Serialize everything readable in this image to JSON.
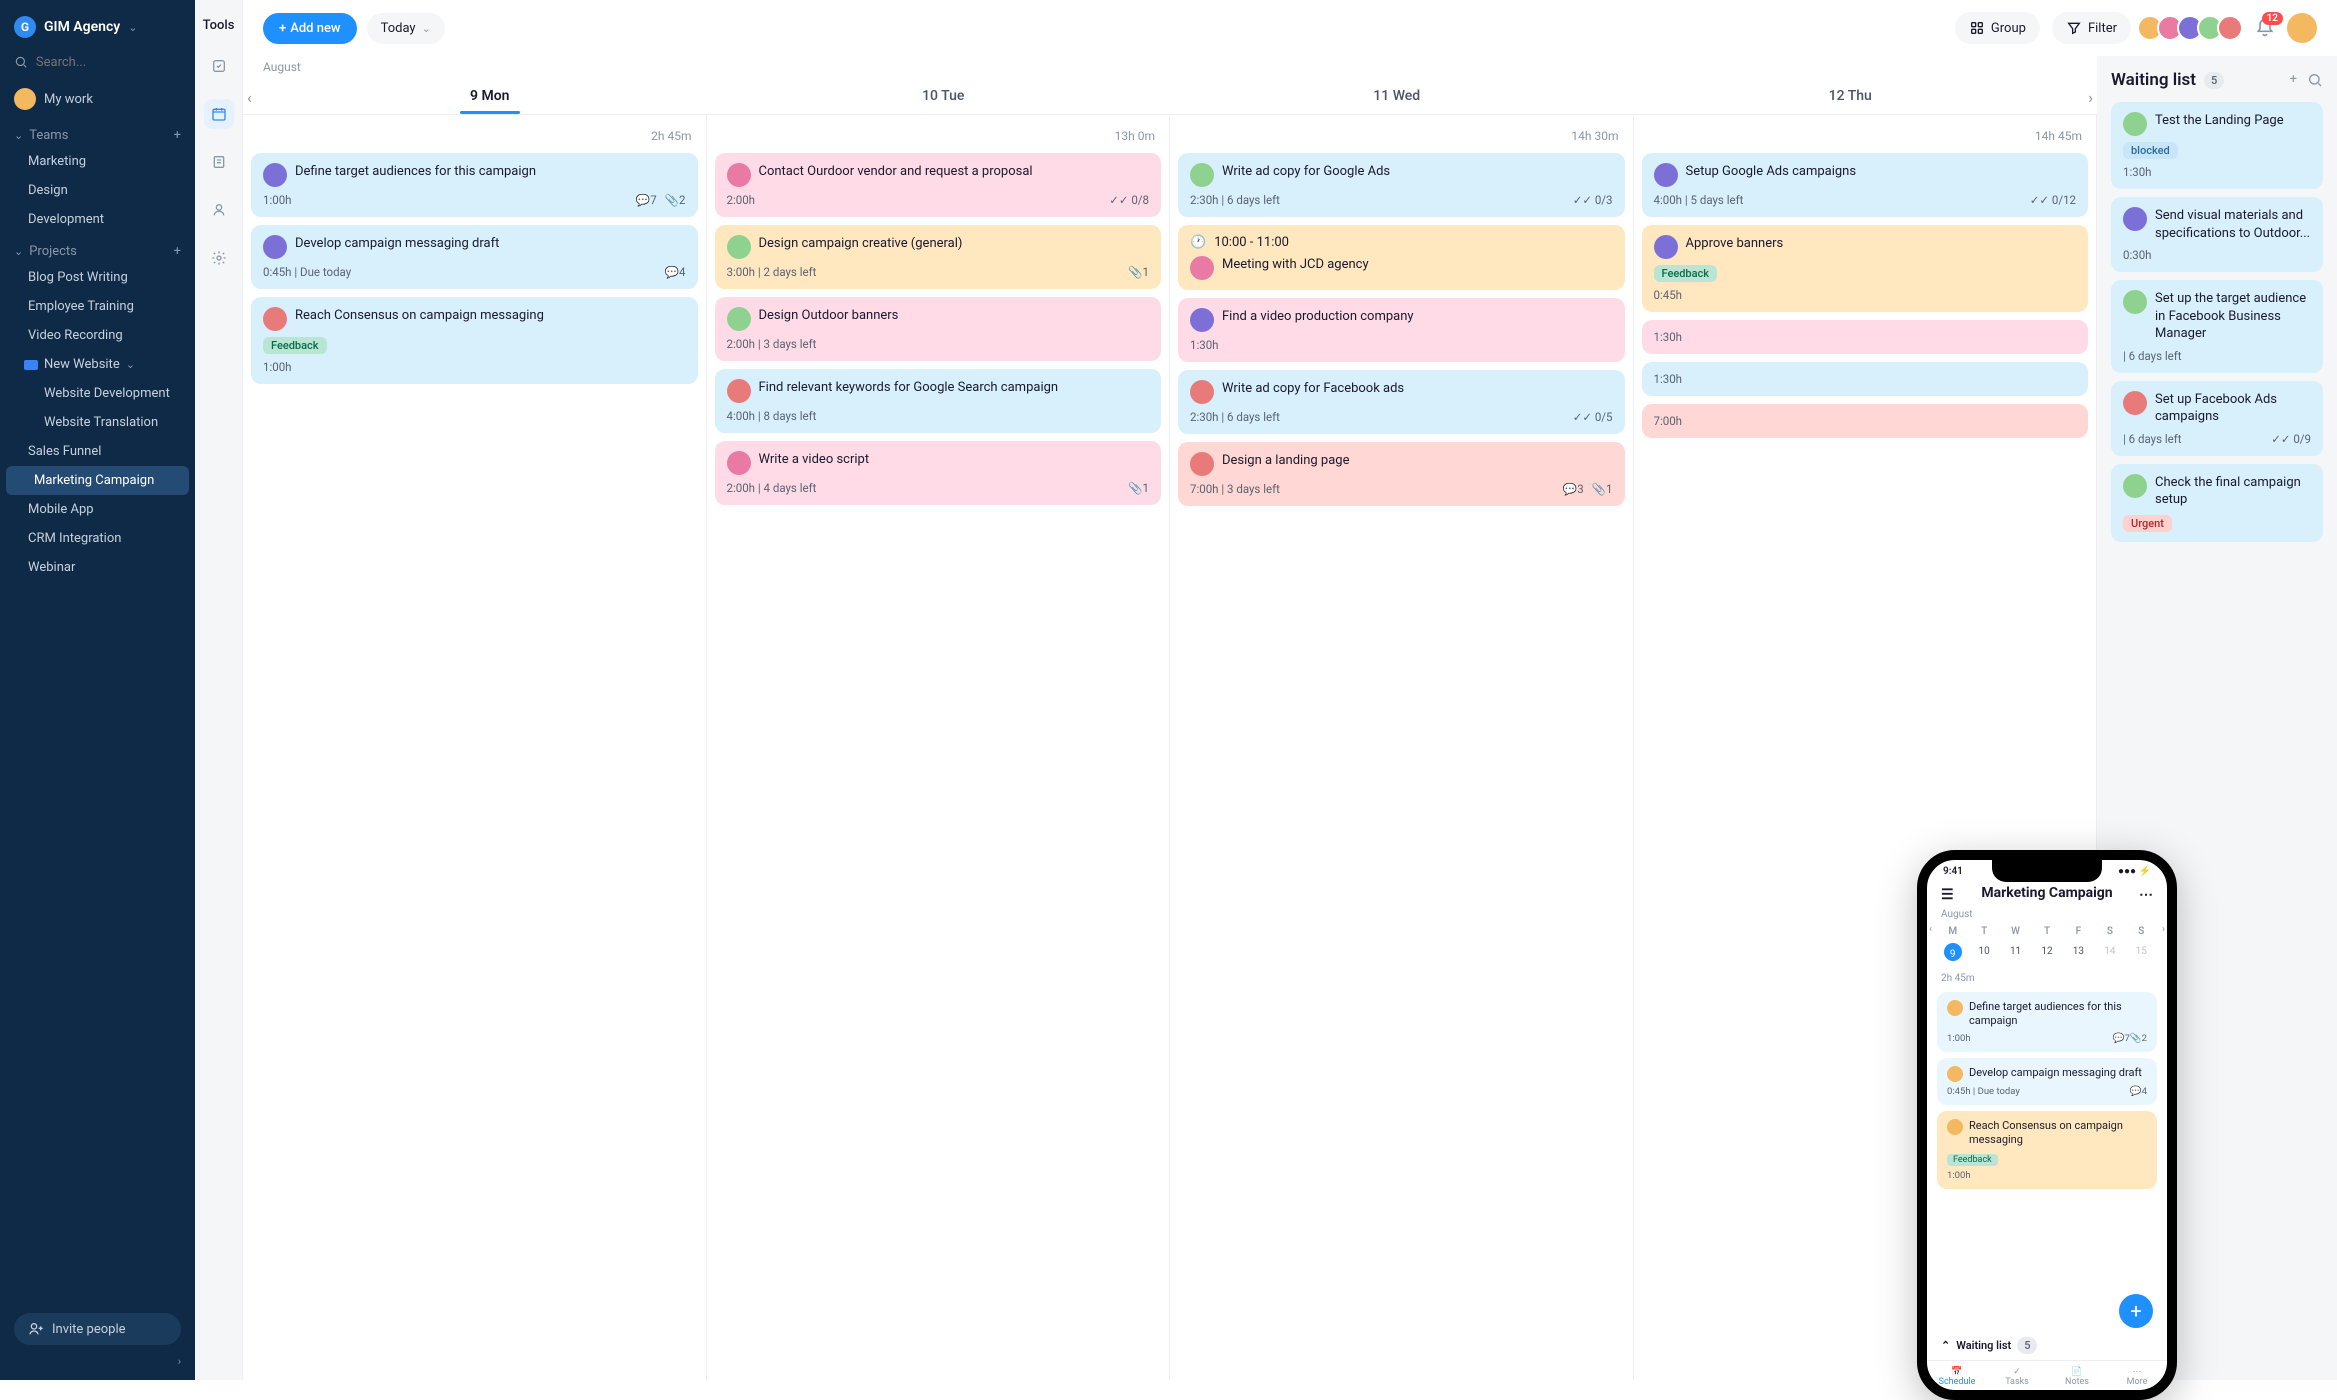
{
  "workspace": {
    "logo_letter": "G",
    "name": "GIM Agency"
  },
  "search": {
    "placeholder": "Search..."
  },
  "nav": {
    "my_work": "My work"
  },
  "teams": {
    "header": "Teams",
    "items": [
      "Marketing",
      "Design",
      "Development"
    ]
  },
  "projects": {
    "header": "Projects",
    "items_top": [
      "Blog Post Writing",
      "Employee Training",
      "Video Recording"
    ],
    "folder": "New Website",
    "folder_items": [
      "Website Development",
      "Website Translation"
    ],
    "items_bottom": [
      "Sales Funnel",
      "Marketing Campaign",
      "Mobile App",
      "CRM Integration",
      "Webinar"
    ],
    "active": "Marketing Campaign"
  },
  "invite": {
    "label": "Invite people"
  },
  "rail": {
    "title": "Tools"
  },
  "topbar": {
    "add_new": "Add new",
    "today": "Today",
    "group": "Group",
    "filter": "Filter",
    "notifications": "12"
  },
  "board": {
    "month": "August",
    "days": [
      {
        "label": "9 Mon",
        "total": "2h 45m",
        "active": true
      },
      {
        "label": "10 Tue",
        "total": "13h 0m"
      },
      {
        "label": "11 Wed",
        "total": "14h 30m"
      },
      {
        "label": "12 Thu",
        "total": "14h 45m"
      }
    ],
    "columns": [
      [
        {
          "color": "blue",
          "title": "Define target audiences for this campaign",
          "meta_left": "1:00h",
          "comments": "7",
          "attach": "2"
        },
        {
          "color": "blue",
          "title": "Develop campaign messaging draft",
          "meta_left": "0:45h | Due today",
          "comments": "4"
        },
        {
          "color": "blue",
          "title": "Reach Consensus on campaign messaging",
          "tag": "Feedback",
          "tag_class": "feedback",
          "meta_left": "1:00h"
        }
      ],
      [
        {
          "color": "pink",
          "title": "Contact Ourdoor vendor and request a proposal",
          "meta_left": "2:00h",
          "progress": "0/8"
        },
        {
          "color": "orange",
          "title": "Design campaign creative (general)",
          "meta_left": "3:00h | 2 days left",
          "attach": "1"
        },
        {
          "color": "pink",
          "title": "Design Outdoor banners",
          "meta_left": "2:00h | 3 days left"
        },
        {
          "color": "blue",
          "title": "Find relevant keywords for Google Search campaign",
          "meta_left": "4:00h | 8 days left"
        },
        {
          "color": "pink",
          "title": "Write a video script",
          "meta_left": "2:00h | 4 days left",
          "attach": "1"
        }
      ],
      [
        {
          "color": "blue",
          "title": "Write ad copy for Google Ads",
          "meta_left": "2:30h | 6 days left",
          "progress": "0/3"
        },
        {
          "color": "orange",
          "time": "10:00 - 11:00",
          "title": "Meeting with JCD agency"
        },
        {
          "color": "pink",
          "title": "Find a video production company",
          "meta_left": "1:30h"
        },
        {
          "color": "blue",
          "title": "Write ad copy for Facebook ads",
          "meta_left": "2:30h | 6 days left",
          "progress": "0/5"
        },
        {
          "color": "red",
          "title": "Design a landing page",
          "meta_left": "7:00h | 3 days left",
          "comments": "3",
          "attach": "1"
        }
      ],
      [
        {
          "color": "blue",
          "title": "Setup Google Ads campaigns",
          "meta_left": "4:00h | 5 days left",
          "progress": "0/12"
        },
        {
          "color": "orange",
          "title": "Approve banners",
          "tag": "Feedback",
          "tag_class": "feedback",
          "meta_left": "0:45h"
        },
        {
          "color": "pink",
          "meta_left": "1:30h"
        },
        {
          "color": "blue",
          "meta_left": "1:30h"
        },
        {
          "color": "red",
          "meta_left": "7:00h"
        }
      ]
    ]
  },
  "waiting": {
    "title": "Waiting list",
    "count": "5",
    "cards": [
      {
        "title": "Test the Landing Page",
        "tag": "blocked",
        "tag_class": "blocked",
        "meta_left": "1:30h"
      },
      {
        "title": "Send visual materials and specifications to Outdoor...",
        "meta_left": "0:30h"
      },
      {
        "title": "Set up the target audience in Facebook Business Manager",
        "meta_left": "| 6 days left"
      },
      {
        "title": "Set up Facebook Ads campaigns",
        "meta_left": "| 6 days left",
        "progress": "0/9"
      },
      {
        "title": "Check the final campaign setup",
        "tag": "Urgent",
        "tag_class": "urgent"
      }
    ]
  },
  "phone": {
    "time": "9:41",
    "title": "Marketing Campaign",
    "month": "August",
    "dow": [
      "M",
      "T",
      "W",
      "T",
      "F",
      "S",
      "S"
    ],
    "dates": [
      "9",
      "10",
      "11",
      "12",
      "13",
      "14",
      "15"
    ],
    "total": "2h 45m",
    "cards": [
      {
        "title": "Define target audiences for this campaign",
        "meta_left": "1:00h",
        "comments": "7",
        "attach": "2"
      },
      {
        "title": "Develop campaign messaging draft",
        "meta_left": "0:45h | Due today",
        "comments": "4"
      },
      {
        "title": "Reach Consensus on campaign messaging",
        "tag": "Feedback",
        "meta_left": "1:00h",
        "color": "orange"
      }
    ],
    "waiting_label": "Waiting list",
    "waiting_count": "5",
    "tabs": [
      "Schedule",
      "Tasks",
      "Notes",
      "More"
    ]
  }
}
